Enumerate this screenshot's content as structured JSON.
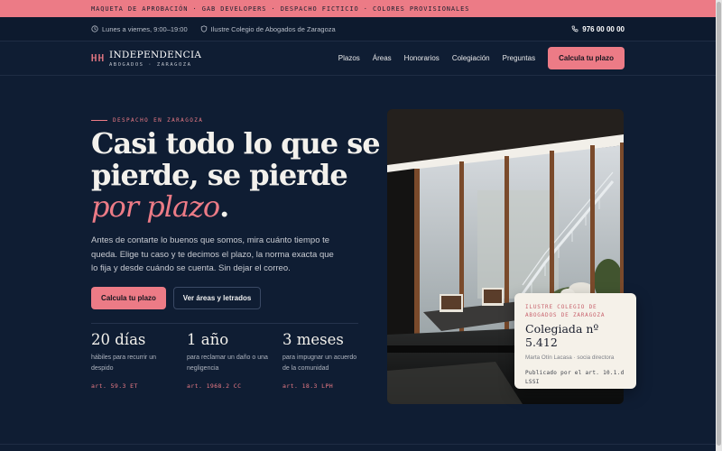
{
  "banner": {
    "text": "MAQUETA DE APROBACIÓN · GAB DEVELOPERS · DESPACHO FICTICIO · COLORES PROVISIONALES"
  },
  "topbar": {
    "hours": "Lunes a viernes, 9:00–19:00",
    "college": "Ilustre Colegio de Abogados de Zaragoza",
    "phone": "976 00 00 00"
  },
  "nav": {
    "brand_name": "INDEPENDENCIA",
    "brand_sub": "ABOGADOS · ZARAGOZA",
    "links": [
      "Plazos",
      "Áreas",
      "Honorarios",
      "Colegiación",
      "Preguntas"
    ],
    "cta": "Calcula tu plazo"
  },
  "hero": {
    "eyebrow": "DESPACHO EN ZARAGOZA",
    "headline_1": "Casi todo lo que se pierde, se pierde ",
    "headline_accent": "por plazo",
    "headline_end": ".",
    "lede": "Antes de contarte lo buenos que somos, mira cuánto tiempo te queda. Elige tu caso y te decimos el plazo, la norma exacta que lo fija y desde cuándo se cuenta. Sin dejar el correo.",
    "primary_button": "Calcula tu plazo",
    "secondary_button": "Ver áreas y letrados"
  },
  "stats": [
    {
      "value": "20 días",
      "desc": "hábiles para recurrir un despido",
      "ref": "art. 59.3 ET"
    },
    {
      "value": "1 año",
      "desc": "para reclamar un daño o una negligencia",
      "ref": "art. 1968.2 CC"
    },
    {
      "value": "3 meses",
      "desc": "para impugnar un acuerdo de la comunidad",
      "ref": "art. 18.3 LPH"
    }
  ],
  "card": {
    "eyebrow": "ILUSTRE COLEGIO DE ABOGADOS DE ZARAGOZA",
    "title": "Colegiada nº 5.412",
    "person": "Marta Otín Lacasa · socia directora",
    "note": "Publicado por el art. 10.1.d LSSI"
  },
  "colors": {
    "accent": "#ec7b86",
    "background": "#0f1d33"
  },
  "icons": {
    "hours": "clock-icon",
    "college": "shield-icon",
    "phone": "phone-icon",
    "brand": "columns-logo-icon"
  }
}
